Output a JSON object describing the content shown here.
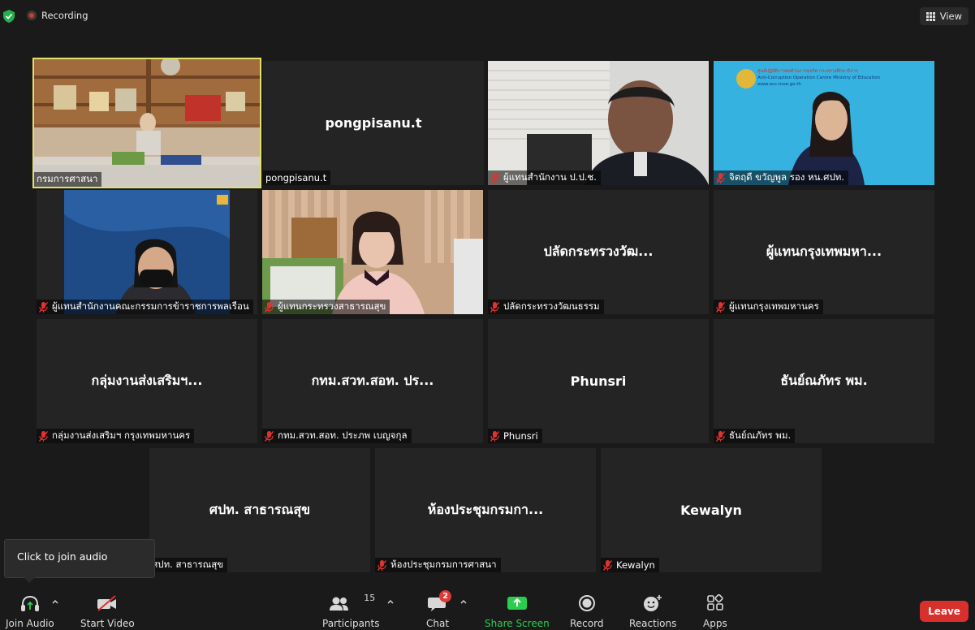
{
  "top_bar": {
    "recording_label": "Recording",
    "view_label": "View"
  },
  "tiles": [
    {
      "name": "กรมการศาสนา",
      "center": "",
      "muted": false,
      "video": true
    },
    {
      "name": "pongpisanu.t",
      "center": "pongpisanu.t",
      "muted": false,
      "video": false
    },
    {
      "name": "ผู้แทนสำนักงาน ป.ป.ช.",
      "center": "",
      "muted": true,
      "video": true
    },
    {
      "name": "จิตฤดี ขวัญพูล รอง หน.ศปท.",
      "center": "",
      "muted": true,
      "video": true
    },
    {
      "name": "ผู้แทนสำนักงานคณะกรรมการข้าราชการพลเรือน",
      "center": "",
      "muted": true,
      "video": true
    },
    {
      "name": "ผู้แทนกระทรวงสาธารณสุข",
      "center": "",
      "muted": true,
      "video": true
    },
    {
      "name": "ปลัดกระทรวงวัฒนธรรม",
      "center": "ปลัดกระทรวงวัฒ...",
      "muted": true,
      "video": false
    },
    {
      "name": "ผู้แทนกรุงเทพมหานคร",
      "center": "ผู้แทนกรุงเทพมหา...",
      "muted": true,
      "video": false
    },
    {
      "name": "กลุ่มงานส่งเสริมฯ กรุงเทพมหานคร",
      "center": "กลุ่มงานส่งเสริมฯ...",
      "muted": true,
      "video": false
    },
    {
      "name": "กทม.สวท.สอท. ประภพ เบญจกุล",
      "center": "กทม.สวท.สอท. ปร...",
      "muted": true,
      "video": false
    },
    {
      "name": "Phunsri",
      "center": "Phunsri",
      "muted": true,
      "video": false
    },
    {
      "name": "ธันย์ณภัทร พม.",
      "center": "ธันย์ณภัทร พม.",
      "muted": true,
      "video": false
    },
    {
      "name": "ศปท. สาธารณสุข",
      "center": "ศปท. สาธารณสุข",
      "muted": false,
      "video": false
    },
    {
      "name": "ห้องประชุมกรมการศาสนา",
      "center": "ห้องประชุมกรมกา...",
      "muted": true,
      "video": false
    },
    {
      "name": "Kewalyn",
      "center": "Kewalyn",
      "muted": true,
      "video": false
    }
  ],
  "acc_banner": {
    "line1": "ศูนย์ปฏิบัติการต่อต้านการทุจริต กระทรวงศึกษาธิการ",
    "line2": "Anti-Corruption Operation Centre Ministry of Education",
    "line3": "www.acc.moe.go.th"
  },
  "tooltip": {
    "text": "Click to join audio"
  },
  "toolbar": {
    "join_audio": "Join Audio",
    "start_video": "Start Video",
    "participants": "Participants",
    "participants_count": "15",
    "chat": "Chat",
    "chat_badge": "2",
    "share_screen": "Share Screen",
    "record": "Record",
    "reactions": "Reactions",
    "apps": "Apps",
    "leave": "Leave"
  },
  "colors": {
    "active_speaker": "#e3e06a",
    "share_green": "#2ccd4e",
    "leave_red": "#d8302c",
    "muted_red": "#e0322f"
  }
}
